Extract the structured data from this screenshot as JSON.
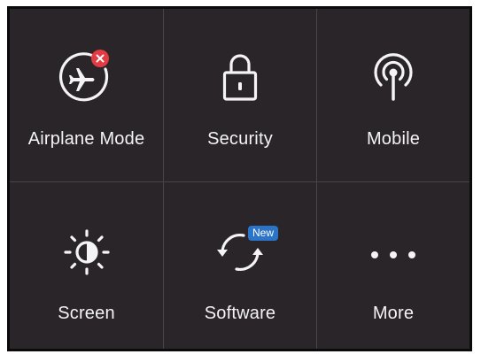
{
  "tiles": [
    {
      "label": "Airplane Mode",
      "icon": "airplane-icon",
      "badge": "error-x"
    },
    {
      "label": "Security",
      "icon": "lock-icon"
    },
    {
      "label": "Mobile",
      "icon": "antenna-icon"
    },
    {
      "label": "Screen",
      "icon": "brightness-icon"
    },
    {
      "label": "Software",
      "icon": "refresh-icon",
      "badge": "New"
    },
    {
      "label": "More",
      "icon": "ellipsis-icon"
    }
  ],
  "colors": {
    "background": "#2a2528",
    "text": "#f4f4f4",
    "divider": "#4a4447",
    "error_badge": "#e23b44",
    "new_badge": "#2c74c8"
  }
}
